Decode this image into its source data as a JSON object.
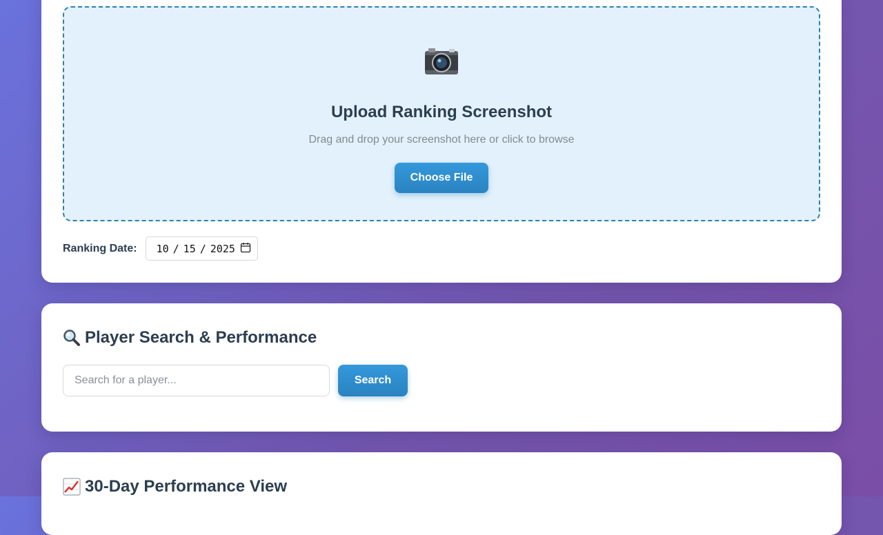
{
  "upload": {
    "icon": "camera-icon",
    "title": "Upload Ranking Screenshot",
    "subtitle": "Drag and drop your screenshot here or click to browse",
    "button_label": "Choose File",
    "date_label": "Ranking Date:",
    "date": {
      "month": "10",
      "day": "15",
      "year": "2025"
    },
    "calendar_icon": "calendar-icon"
  },
  "search": {
    "icon": "magnifier-icon",
    "title": "Player Search & Performance",
    "placeholder": "Search for a player...",
    "value": "",
    "button_label": "Search"
  },
  "performance": {
    "icon": "chart-increasing-icon",
    "title": "30-Day Performance View"
  },
  "colors": {
    "accent": "#3498db",
    "dropzone_bg": "#e3f1fc",
    "dropzone_border": "#2d80ad",
    "heading": "#2c3e50",
    "muted": "#7f8c8d"
  }
}
